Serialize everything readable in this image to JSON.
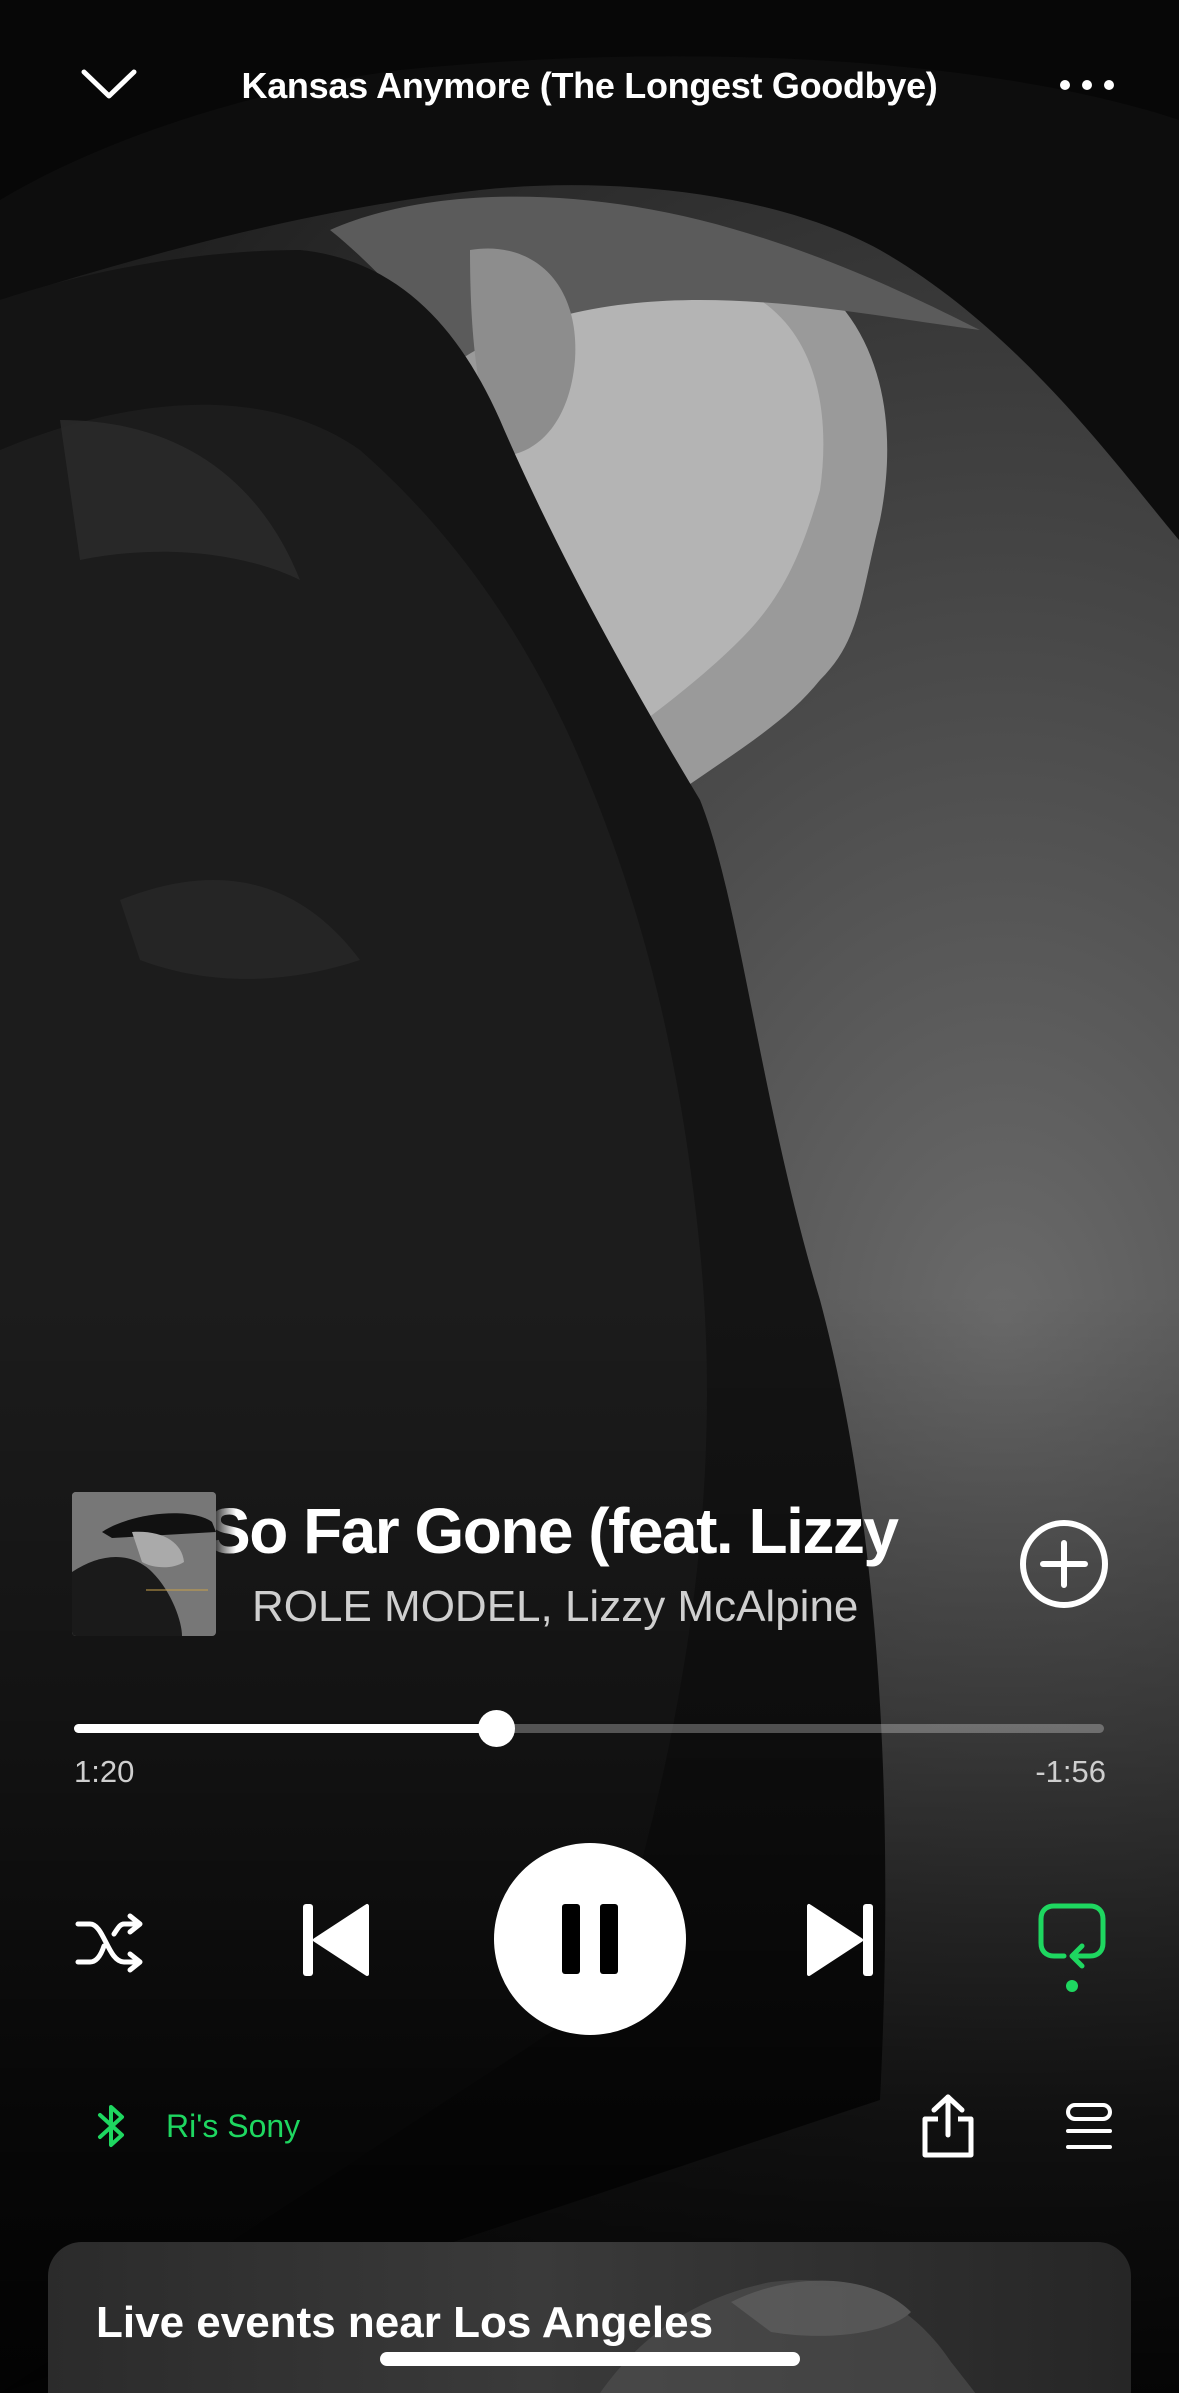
{
  "header": {
    "title": "Kansas Anymore (The Longest Goodbye)",
    "collapse_icon": "chevron-down-icon",
    "more_icon": "more-horizontal-icon"
  },
  "track": {
    "title": "So Far Gone (feat. Lizzy McAlpine)",
    "visible_title": "So Far Gone (feat. Lizzy",
    "artists": "ROLE MODEL, Lizzy McAlpine",
    "add_icon": "add-circle-icon"
  },
  "playback": {
    "elapsed": "1:20",
    "remaining": "-1:56",
    "progress_fraction": 0.41,
    "state": "playing"
  },
  "controls": {
    "shuffle_icon": "shuffle-icon",
    "previous_icon": "skip-previous-icon",
    "pause_icon": "pause-icon",
    "next_icon": "skip-next-icon",
    "repeat_icon": "repeat-icon",
    "repeat_active": true
  },
  "device": {
    "name": "Ri's Sony",
    "icon": "bluetooth-icon"
  },
  "actions": {
    "share_icon": "share-icon",
    "queue_icon": "queue-icon"
  },
  "events_card": {
    "heading": "Live events near Los Angeles"
  },
  "colors": {
    "accent": "#1ed760",
    "foreground": "#ffffff",
    "secondary_text": "#cfcfcf",
    "background": "#000000"
  }
}
